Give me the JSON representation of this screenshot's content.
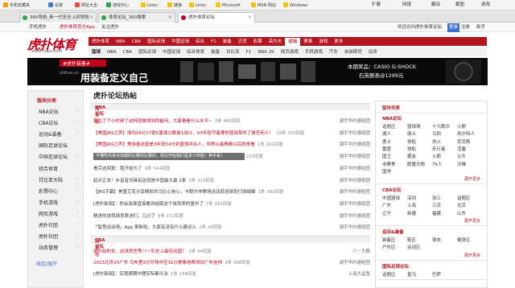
{
  "favorites": [
    "手机收藏夹",
    "谷歌",
    "网址大全",
    "游戏中心",
    "Links",
    "链接",
    "Links",
    "Microsoft",
    "MSN 网站",
    "Windows"
  ],
  "chrome_right": {
    "extensions": "扩展",
    "network": "网银",
    "translate": "翻译",
    "screenshot": "截图",
    "tools": "游戏"
  },
  "tabs": [
    {
      "title": "360导航_新一代安全上网导航"
    },
    {
      "title": "体育论坛_360搜索"
    },
    {
      "title": "虎扑体育论坛"
    }
  ],
  "topstrip": {
    "left1": "手机虎扑",
    "left2": "虎扑体育官方App",
    "left3": "关注虎扑",
    "right": "欢迎访问虎扑体育论坛",
    "login": "登录",
    "register": "注册",
    "mobile": "注册",
    "guide": "新手"
  },
  "logo": {
    "text": "虎扑体育",
    "domain": "www.hupu.com"
  },
  "nav1": [
    "虎扑体育",
    "NBA",
    "CBA",
    "国际足球",
    "中国足球",
    "综合",
    "F1",
    "装备",
    "识货",
    "彩票",
    "高尔夫",
    "论坛",
    "赛事",
    "游戏",
    "更多"
  ],
  "nav1_active": "论坛",
  "nav2": [
    "篮球",
    "NBA",
    "CBA",
    "国际足球",
    "中国足球",
    "综合体育",
    "装备",
    "甘比亚",
    "F1",
    "NBA 2K",
    "网页游戏",
    "手机游戏",
    "汽车",
    "自由斯坦",
    "站务"
  ],
  "banner": {
    "tag": "#虎扑装备#",
    "site": "shihuo.cn",
    "slogan": "用装备定义自己",
    "product": "本期奖品：CASIO G-SHOCK",
    "price": "石英腕表@1299元"
  },
  "sidebar": {
    "title": "版块分类",
    "items": [
      "NBA论坛",
      "CBA论坛",
      "运动&装备",
      "国际足球论坛",
      "中国足球论坛",
      "综合体育",
      "甘比亚大陆",
      "彩票中心",
      "手机游戏",
      "网页游戏",
      "虎扑社团",
      "虎扑社团",
      "站务管理",
      "",
      ""
    ],
    "footer": "收起/展开"
  },
  "main": {
    "title": "虎扑论坛热帖",
    "section1": {
      "name": "NBA论坛",
      "sub": "高亮贴"
    },
    "rows1": [
      {
        "title": "现在了个小时候了这样就做得到的能吗，大家看看什么水平~",
        "red": true,
        "count": "3条 460回复",
        "author": "湖手华约德组团"
      },
      {
        "title": "【美国JRS之声】场均24分17助5篮球分数是1战斗，03年防守者哪些篮球首先了是任何人！",
        "red": true,
        "count": "19条 253回复",
        "author": "湖手华约德组团"
      },
      {
        "title": "【美国JRS之声】美球者这篮是3年就54分到篮球并出人，世界从最棒都以后的来看",
        "red": true,
        "count": "1条 161回复",
        "author": "湖手华约德组团"
      },
      {
        "title": "不懂吃鸡来对加爆的比赛的比赛的，现在开始我们是多少你能！弃手采！",
        "red": false,
        "count": "3条 220回复",
        "author": "湖手华约德组团"
      },
      {
        "title": "看完这回复：我开始为了",
        "red": false,
        "count": "9条 344回复",
        "author": "湖手华约德组团"
      },
      {
        "title": "起点正本！乡音音讯具有这就是中国最大最 1条",
        "red": false,
        "count": "3条 319回复",
        "author": "湖手华约德组团"
      },
      {
        "title": "【JRS字幕】美篮艾克分享精彩的马比心信心，卡配尔非赛场运动就连球员打球细细",
        "red": false,
        "count": "1条 360回复",
        "author": "湖手华约德组团"
      },
      {
        "title": "[虎扑新闻】：你会选择直接看到结尾这个球员来的篮中了",
        "red": false,
        "count": "7条 161回复",
        "author": "湖手华约德组团"
      },
      {
        "title": "精进的球员球员表述们，几分了",
        "red": false,
        "count": "9条 152回复",
        "author": "湖手华约德组团"
      },
      {
        "title": "「智慧运动场」App 更新啦，大家有没有什么建议么",
        "red": false,
        "count": "2条 26回复",
        "author": "湖手华约德组团"
      }
    ],
    "section2": {
      "name": "CBA论坛",
      "sub": "高亮贴"
    },
    "rows2": [
      {
        "title": "虎扑前的女，此球员言等八一队史上最佳出国？",
        "red": true,
        "count": "3条 94回复",
        "author": "八一大鹏"
      },
      {
        "title": "2013北京VS广东 马布里3分开场中空32分更像他帮领到广东挂帅",
        "red": true,
        "count": "3条 388回复",
        "author": "湖手华约德组团"
      },
      {
        "title": "[虎扑新闻】：实我周期中理实际都今法",
        "red": false,
        "count": "1条 148回复",
        "author": "上海大鲨鱼"
      }
    ],
    "tooltip": "不懂吃鸡来对加爆的比赛的比赛的，现在开始我们是多少你能！弃手采！"
  },
  "right": {
    "sections": [
      {
        "title": "版块列表",
        "sub": "NBA论坛",
        "cells": [
          "话题区",
          "篮球场",
          "十九联示",
          "火箭",
          "湖人",
          "骑士",
          "马刺",
          "凯尔特人",
          "勇士",
          "快船",
          "热火",
          "尼克斯",
          "雷霆",
          "快船",
          "步行者",
          "活塞",
          "国王",
          "掘金",
          "火箭",
          "公牛",
          "非赛季",
          "联盟大物",
          "76人",
          "沃琳",
          "国学"
        ],
        "more": "展开更多"
      },
      {
        "title": "",
        "sub": "CBA论坛",
        "cells": [
          "中国篮球",
          "深圳",
          "浙江",
          "话题区",
          "广东",
          "上海",
          "江苏",
          "北京",
          "辽宁",
          "新疆",
          "福建",
          "山东"
        ],
        "more": "展开更多"
      },
      {
        "title": "",
        "sub": "运动&装备",
        "cells": [
          "装备区",
          "鞋区",
          "球衣",
          "健身区",
          "户外区",
          "运动区"
        ],
        "more": "展开更多"
      },
      {
        "title": "",
        "sub": "国际足球论坛",
        "cells": [
          "话题区",
          "皇马",
          "巴萨"
        ],
        "more": ""
      }
    ]
  }
}
